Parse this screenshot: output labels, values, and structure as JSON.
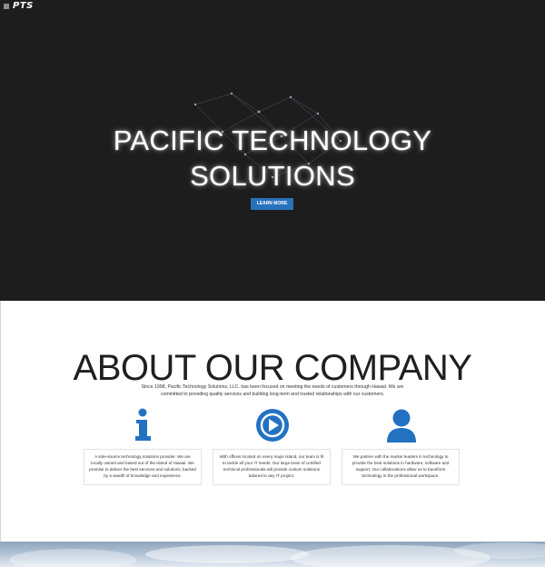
{
  "header": {
    "menu_icon": "hamburger-icon",
    "logo_text": "PTS"
  },
  "hero": {
    "title_line1": "PACIFIC TECHNOLOGY",
    "title_line2": "SOLUTIONS",
    "button_label": "LEARN MORE",
    "background_color": "#1e1d1e",
    "button_color": "#2672bd"
  },
  "about": {
    "heading": "ABOUT OUR COMPANY",
    "intro": "Since 1998, Pacific Technology Solutions, LLC. has been focused on meeting the needs of customers through Hawaii. We are committed to providing quality services and building long-term and trusted relationships with our customers.",
    "features": [
      {
        "icon": "info-icon",
        "text": "A sole-source technology solutions provider. We are locally owned and based out of the island of Hawaii. We promise to deliver the best services and solutions, backed by a wealth of knowledge and experience."
      },
      {
        "icon": "play-circle-icon",
        "text": "With offices located on every major island, our team is fit to tackle all your IT needs. Our large team of certified technical professionals will provide custom solutions tailored to any IT project."
      },
      {
        "icon": "user-icon",
        "text": "We partner with the market leaders in technology to provide the best solutions in hardware, software and support. Our collaborations allow us to transform technology in the professional workspace."
      }
    ],
    "icon_color": "#2372c2"
  }
}
